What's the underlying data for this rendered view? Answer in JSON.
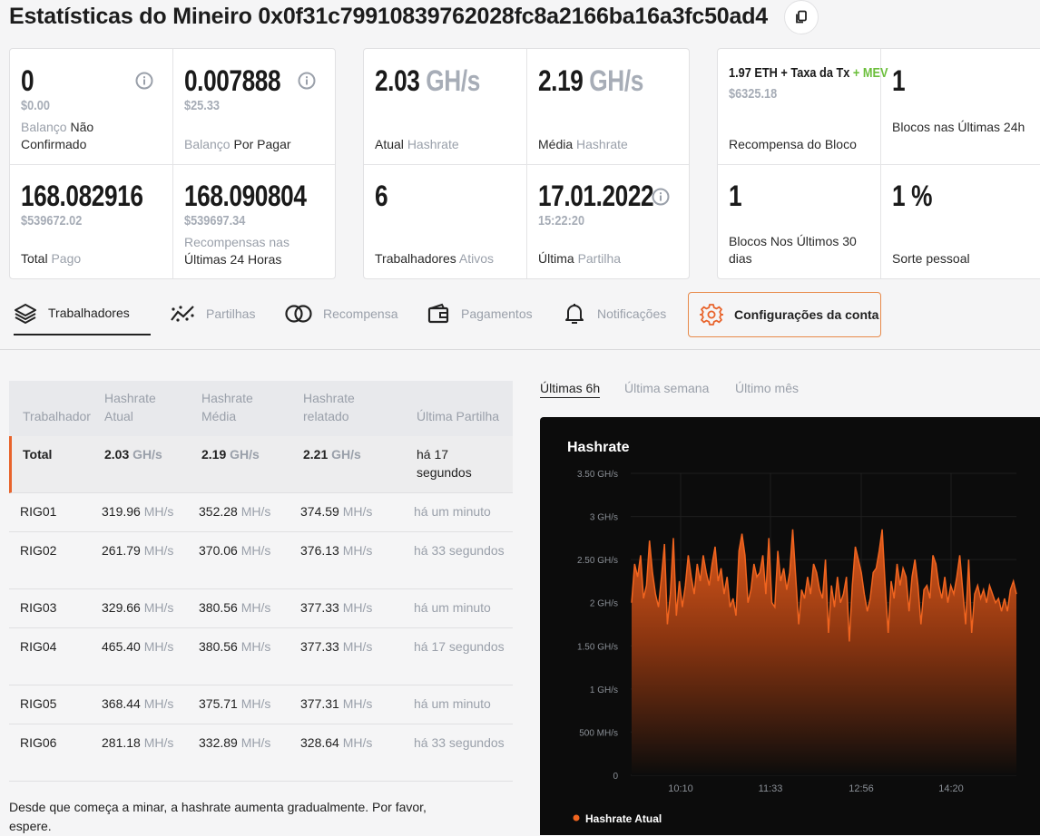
{
  "header": {
    "title": "Estatísticas do Mineiro 0x0f31c79910839762028fc8a2166ba16a3fc50ad4"
  },
  "stats": {
    "unconfirmed": {
      "value": "0",
      "usd": "$0.00",
      "label_g": "Balanço",
      "label_d": " Não Confirmado"
    },
    "unpaid": {
      "value": "0.007888",
      "usd": "$25.33",
      "label_g": "Balanço",
      "label_d": " Por Pagar"
    },
    "current_hashrate": {
      "value": "2.03",
      "unit": " GH/s",
      "label_d": "Atual ",
      "label_g": "Hashrate"
    },
    "avg_hashrate": {
      "value": "2.19",
      "unit": " GH/s",
      "label_d": "Média ",
      "label_g": "Hashrate"
    },
    "block_reward": {
      "eth": "1.97 ETH + Taxa da Tx ",
      "mev": "+ MEV",
      "usd": "$6325.18",
      "label": "Recompensa do Bloco"
    },
    "blocks_24h": {
      "value": "1",
      "label": "Blocos nas Últimas 24h"
    },
    "total_paid": {
      "value": "168.082916",
      "usd": "$539672.02",
      "label_d": "Total ",
      "label_g": "Pago"
    },
    "rewards_24h": {
      "value": "168.090804",
      "usd": "$539697.34",
      "label_g": "Recompensas nas ",
      "label_d": "Últimas 24 Horas"
    },
    "active_workers": {
      "value": "6",
      "label_d": "Trabalhadores ",
      "label_g": "Ativos"
    },
    "last_share": {
      "value": "17.01.2022",
      "time": "15:22:20",
      "label_d": "Última ",
      "label_g": "Partilha"
    },
    "blocks_30d": {
      "value": "1",
      "label": "Blocos Nos Últimos 30 dias"
    },
    "luck": {
      "value": "1 %",
      "label": "Sorte pessoal"
    }
  },
  "tabs": [
    {
      "label": "Trabalhadores",
      "icon": "layers-icon"
    },
    {
      "label": "Partilhas",
      "icon": "scatter-icon"
    },
    {
      "label": "Recompensa",
      "icon": "coins-icon"
    },
    {
      "label": "Pagamentos",
      "icon": "wallet-icon"
    },
    {
      "label": "Notificações",
      "icon": "bell-icon"
    },
    {
      "label": "Configurações da conta",
      "icon": "gear-icon"
    }
  ],
  "table": {
    "headers": {
      "worker": "Trabalhador",
      "current": "Hashrate Atual",
      "average": "Hashrate Média",
      "reported": "Hashrate relatado",
      "last_share": "Última Partilha"
    },
    "total": {
      "name": "Total",
      "current": "2.03",
      "average": "2.19",
      "reported": "2.21",
      "unit": " GH/s",
      "last_share": "há 17 segundos"
    },
    "rows": [
      {
        "name": "RIG01",
        "current": "319.96",
        "average": "352.28",
        "reported": "374.59",
        "unit": " MH/s",
        "last_share": "há um minuto"
      },
      {
        "name": "RIG02",
        "current": "261.79",
        "average": "370.06",
        "reported": "376.13",
        "unit": " MH/s",
        "last_share": "há 33 segundos"
      },
      {
        "name": "RIG03",
        "current": "329.66",
        "average": "380.56",
        "reported": "377.33",
        "unit": " MH/s",
        "last_share": "há um minuto"
      },
      {
        "name": "RIG04",
        "current": "465.40",
        "average": "380.56",
        "reported": "377.33",
        "unit": " MH/s",
        "last_share": "há 17 segundos"
      },
      {
        "name": "RIG05",
        "current": "368.44",
        "average": "375.71",
        "reported": "377.31",
        "unit": " MH/s",
        "last_share": "há um minuto"
      },
      {
        "name": "RIG06",
        "current": "281.18",
        "average": "332.89",
        "reported": "328.64",
        "unit": " MH/s",
        "last_share": "há 33 segundos"
      }
    ]
  },
  "note": "Desde que começa a minar, a hashrate aumenta gradualmente. Por favor, espere.",
  "period_tabs": [
    "Últimas 6h",
    "Última semana",
    "Último mês"
  ],
  "chart_data": {
    "type": "area",
    "title": "Hashrate",
    "y_tick_labels": [
      "0",
      "500 MH/s",
      "1 GH/s",
      "1.50 GH/s",
      "2 GH/s",
      "2.50 GH/s",
      "3 GH/s",
      "3.50 GH/s"
    ],
    "x_tick_labels": [
      "10:10",
      "11:33",
      "12:56",
      "14:20"
    ],
    "ylim": [
      0,
      3.5
    ],
    "y_unit": "GH/s",
    "legend": "Hashrate Atual",
    "series": [
      {
        "name": "Hashrate Atual",
        "color": "#e8632b",
        "values": [
          2.0,
          2.45,
          2.3,
          2.55,
          2.05,
          2.2,
          2.72,
          2.35,
          2.1,
          1.95,
          2.3,
          2.68,
          1.75,
          2.1,
          2.75,
          1.85,
          2.25,
          1.95,
          2.2,
          2.55,
          2.3,
          2.1,
          2.45,
          2.25,
          2.55,
          2.35,
          2.2,
          2.45,
          2.65,
          2.25,
          2.4,
          2.1,
          2.3,
          1.95,
          2.05,
          1.85,
          2.6,
          2.8,
          2.55,
          2.0,
          2.15,
          2.45,
          2.3,
          2.35,
          2.55,
          2.1,
          2.75,
          2.0,
          1.95,
          2.6,
          2.25,
          2.4,
          2.15,
          2.35,
          2.85,
          2.3,
          1.75,
          2.15,
          2.05,
          2.3,
          2.1,
          2.45,
          2.35,
          2.15,
          2.05,
          2.5,
          1.65,
          2.2,
          1.95,
          2.3,
          2.0,
          2.1,
          2.3,
          1.55,
          2.2,
          2.65,
          2.5,
          2.35,
          2.1,
          1.9,
          2.05,
          2.35,
          2.4,
          2.6,
          2.85,
          2.2,
          1.65,
          2.25,
          2.05,
          2.45,
          2.2,
          2.4,
          2.3,
          1.9,
          2.3,
          2.5,
          2.2,
          1.75,
          2.15,
          2.2,
          2.05,
          2.55,
          2.45,
          2.2,
          2.05,
          2.3,
          2.0,
          2.2,
          2.1,
          2.3,
          2.55,
          2.15,
          1.75,
          2.5,
          1.65,
          2.1,
          2.2,
          2.05,
          2.15,
          2.0,
          2.2,
          2.1,
          2.0,
          2.05,
          1.9,
          2.05,
          1.9,
          2.15,
          2.25,
          2.1
        ]
      }
    ]
  },
  "colors": {
    "accent": "#e8632b",
    "mev": "#6cbf3c",
    "muted": "#9aa0aa"
  }
}
